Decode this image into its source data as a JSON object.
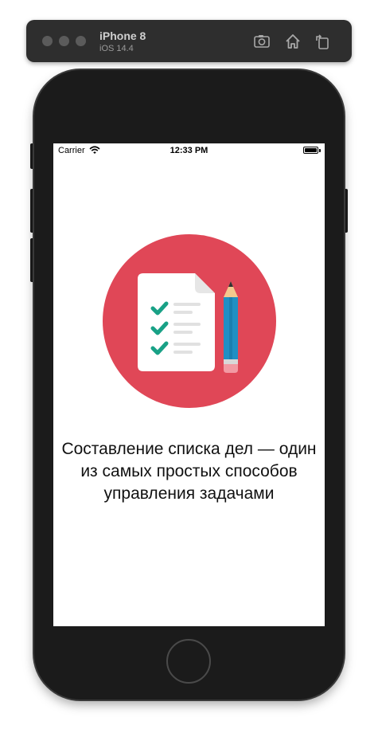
{
  "simulator": {
    "device_name": "iPhone 8",
    "os_version": "iOS 14.4",
    "toolbar_icons": [
      "screenshot-icon",
      "home-icon",
      "rotate-icon"
    ]
  },
  "status_bar": {
    "carrier": "Carrier",
    "time": "12:33 PM"
  },
  "onboarding": {
    "illustration": "todo-list-with-pencil-icon",
    "caption": "Составление списка дел — один из самых простых способов управления задачами"
  },
  "colors": {
    "accent_circle": "#E04757",
    "check_green": "#19A186",
    "pencil_blue": "#1F8FC4",
    "phone_body": "#1B1B1B"
  }
}
